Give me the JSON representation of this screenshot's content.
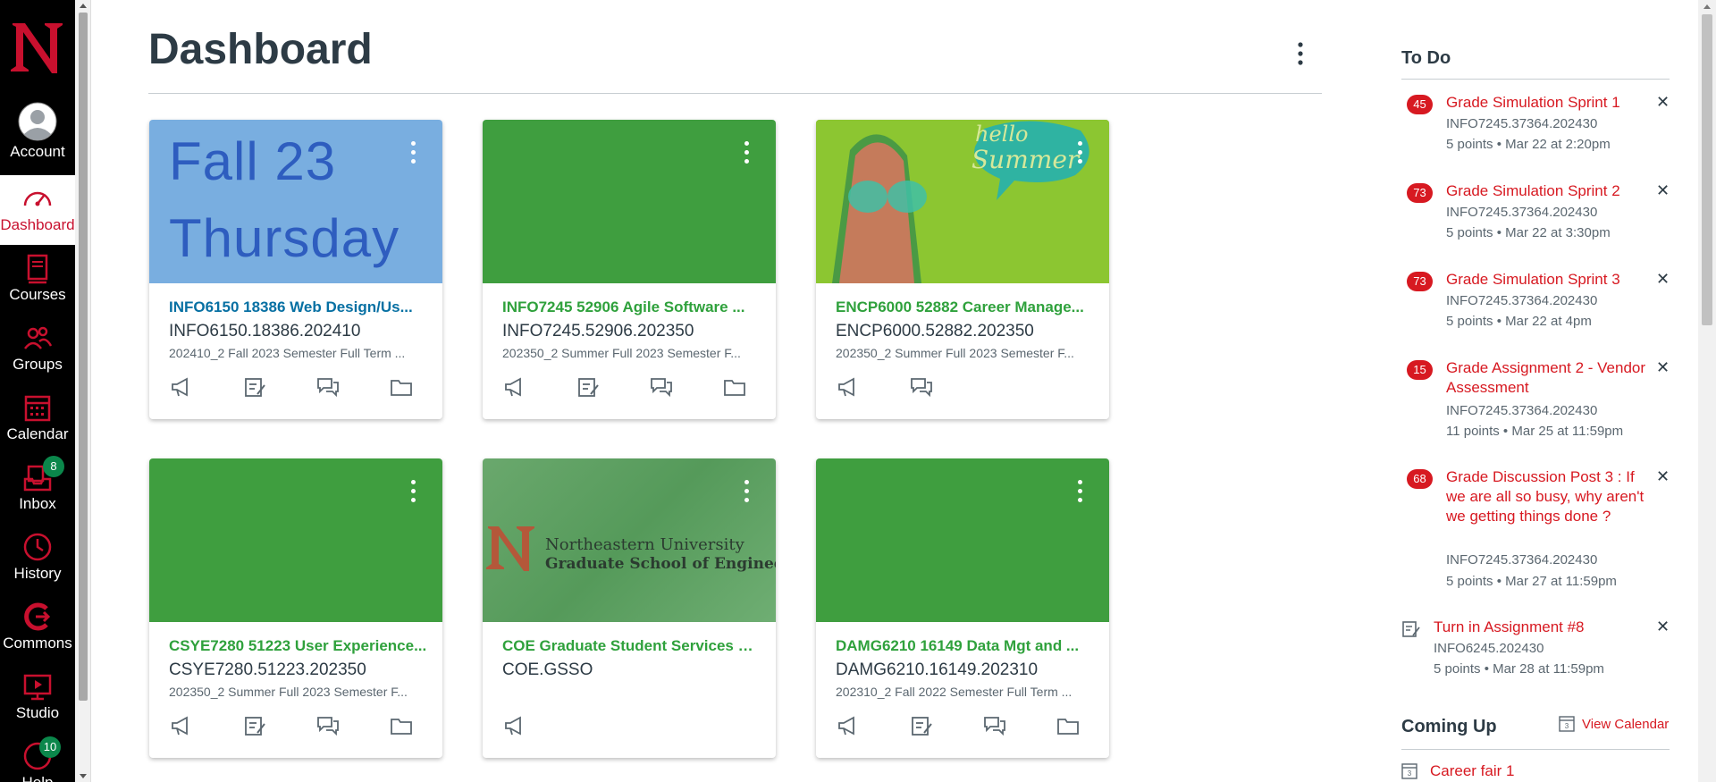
{
  "nav": {
    "items": [
      {
        "label": "Account",
        "icon": "account-icon"
      },
      {
        "label": "Dashboard",
        "icon": "dashboard-icon"
      },
      {
        "label": "Courses",
        "icon": "courses-icon"
      },
      {
        "label": "Groups",
        "icon": "groups-icon"
      },
      {
        "label": "Calendar",
        "icon": "calendar-icon"
      },
      {
        "label": "Inbox",
        "icon": "inbox-icon",
        "badge": "8"
      },
      {
        "label": "History",
        "icon": "history-icon"
      },
      {
        "label": "Commons",
        "icon": "commons-icon"
      },
      {
        "label": "Studio",
        "icon": "studio-icon"
      },
      {
        "label": "Help",
        "icon": "help-icon",
        "badge": "10"
      }
    ]
  },
  "header": {
    "title": "Dashboard"
  },
  "cards": [
    {
      "title": "INFO6150 18386 Web Design/Us...",
      "code": "INFO6150.18386.202410",
      "term": "202410_2 Fall 2023 Semester Full Term ...",
      "color": "#0770a3",
      "hero_color": "#79aee0",
      "hero_text": [
        "Fall 23",
        "Thursday"
      ]
    },
    {
      "title": "INFO7245 52906 Agile Software ...",
      "code": "INFO7245.52906.202350",
      "term": "202350_2 Summer Full 2023 Semester F...",
      "color": "#2fa13c",
      "hero_color": "#3f9e3f"
    },
    {
      "title": "ENCP6000 52882 Career Manage...",
      "code": "ENCP6000.52882.202350",
      "term": "202350_2 Summer Full 2023 Semester F...",
      "color": "#2fa13c",
      "hero_color": "#8cc631",
      "hero_text": [
        "hello",
        "Summer"
      ]
    },
    {
      "title": "CSYE7280 51223 User Experience...",
      "code": "CSYE7280.51223.202350",
      "term": "202350_2 Summer Full 2023 Semester F...",
      "color": "#2fa13c",
      "hero_color": "#3f9e3f"
    },
    {
      "title": "COE Graduate Student Services O...",
      "code": "COE.GSSO",
      "term": "",
      "color": "#2fa13c",
      "hero_color": "#5e9e63",
      "hero_text": [
        "Northeastern University",
        "Graduate School of Engineering"
      ]
    },
    {
      "title": "DAMG6210 16149 Data Mgt and ...",
      "code": "DAMG6210.16149.202310",
      "term": "202310_2 Fall 2022 Semester Full Term ...",
      "color": "#2fa13c",
      "hero_color": "#3f9e3f"
    }
  ],
  "todo": {
    "heading": "To Do",
    "items": [
      {
        "badge": "45",
        "title": "Grade Simulation Sprint 1",
        "course": "INFO7245.37364.202430",
        "meta": "5 points • Mar 22 at 2:20pm"
      },
      {
        "badge": "73",
        "title": "Grade Simulation Sprint 2",
        "course": "INFO7245.37364.202430",
        "meta": "5 points • Mar 22 at 3:30pm"
      },
      {
        "badge": "73",
        "title": "Grade Simulation Sprint 3",
        "course": "INFO7245.37364.202430",
        "meta": "5 points • Mar 22 at 4pm"
      },
      {
        "badge": "15",
        "title": "Grade Assignment 2 - Vendor Assessment",
        "course": "INFO7245.37364.202430",
        "meta": "11 points • Mar 25 at 11:59pm"
      },
      {
        "badge": "68",
        "title": "Grade Discussion Post 3 : If we are all so busy, why aren't we getting things done ?",
        "course": "INFO7245.37364.202430",
        "meta": "5 points • Mar 27 at 11:59pm"
      },
      {
        "title": "Turn in Assignment #8",
        "course": "INFO6245.202430",
        "meta": "5 points • Mar 28 at 11:59pm"
      }
    ]
  },
  "coming_up": {
    "heading": "Coming Up",
    "view_calendar": "View Calendar",
    "items": [
      "Career fair 1"
    ]
  },
  "colors": {
    "brand_red": "#c8102e",
    "link_red": "#d71921",
    "green": "#2fa13c"
  }
}
